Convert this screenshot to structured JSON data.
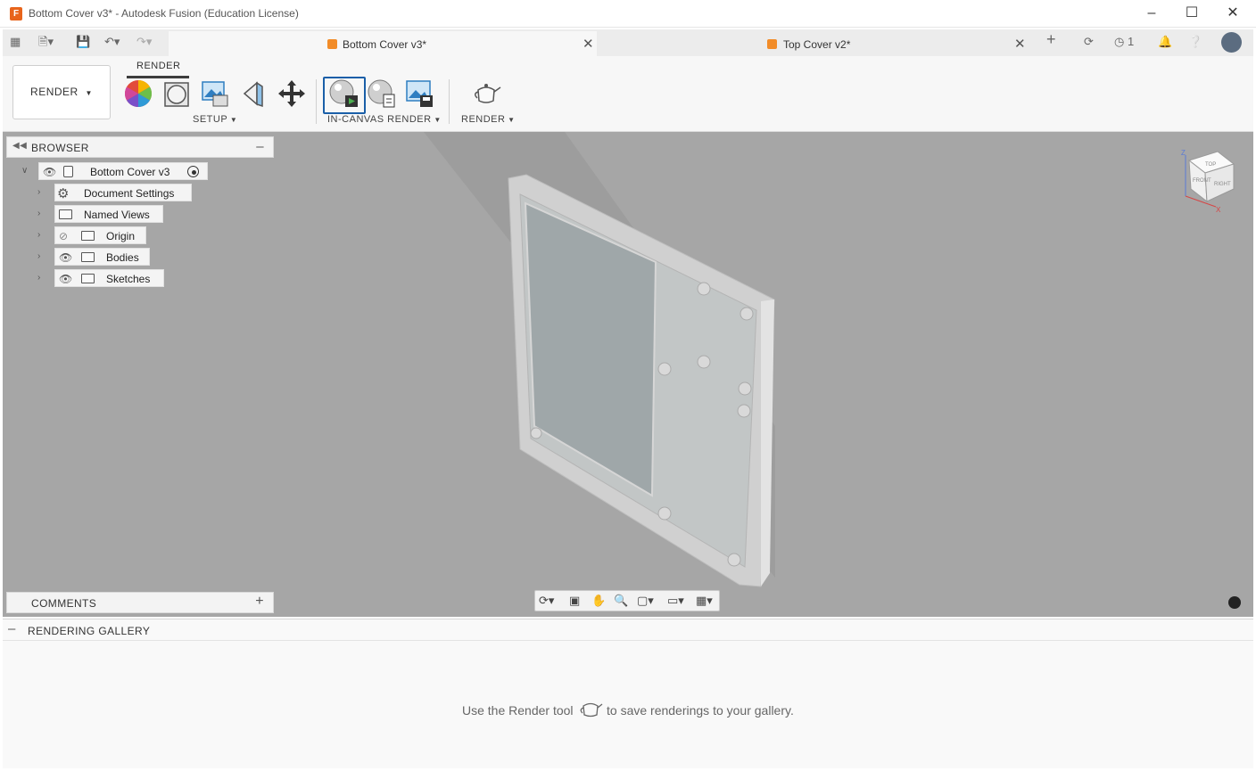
{
  "window": {
    "title": "Bottom Cover v3* - Autodesk Fusion (Education License)",
    "app_icon": "F"
  },
  "tabs": [
    {
      "label": "Bottom Cover v3*",
      "active": true
    },
    {
      "label": "Top Cover v2*",
      "active": false
    }
  ],
  "header": {
    "job_count": "1"
  },
  "toolbar": {
    "workspace": "RENDER",
    "tab_title": "RENDER",
    "groups": {
      "setup": "SETUP",
      "in_canvas": "IN-CANVAS RENDER",
      "render": "RENDER"
    }
  },
  "browser": {
    "title": "BROWSER",
    "root": "Bottom Cover v3",
    "items": [
      {
        "label": "Document Settings",
        "icon": "gear-icon"
      },
      {
        "label": "Named Views",
        "icon": "folder-icon"
      },
      {
        "label": "Origin",
        "icon": "folder-icon",
        "visibility": "hidden"
      },
      {
        "label": "Bodies",
        "icon": "folder-icon",
        "visibility": "visible"
      },
      {
        "label": "Sketches",
        "icon": "folder-icon",
        "visibility": "visible"
      }
    ]
  },
  "viewcube": {
    "faces": [
      "TOP",
      "FRONT",
      "RIGHT"
    ],
    "axes": [
      "Z",
      "X"
    ]
  },
  "comments": {
    "title": "COMMENTS"
  },
  "gallery": {
    "title": "RENDERING GALLERY",
    "hint_before": "Use the Render tool",
    "hint_after": "to save renderings to your gallery."
  },
  "colors": {
    "canvas": "#a6a6a6",
    "accent": "#1a5fa8",
    "brand_orange": "#e8641b"
  }
}
